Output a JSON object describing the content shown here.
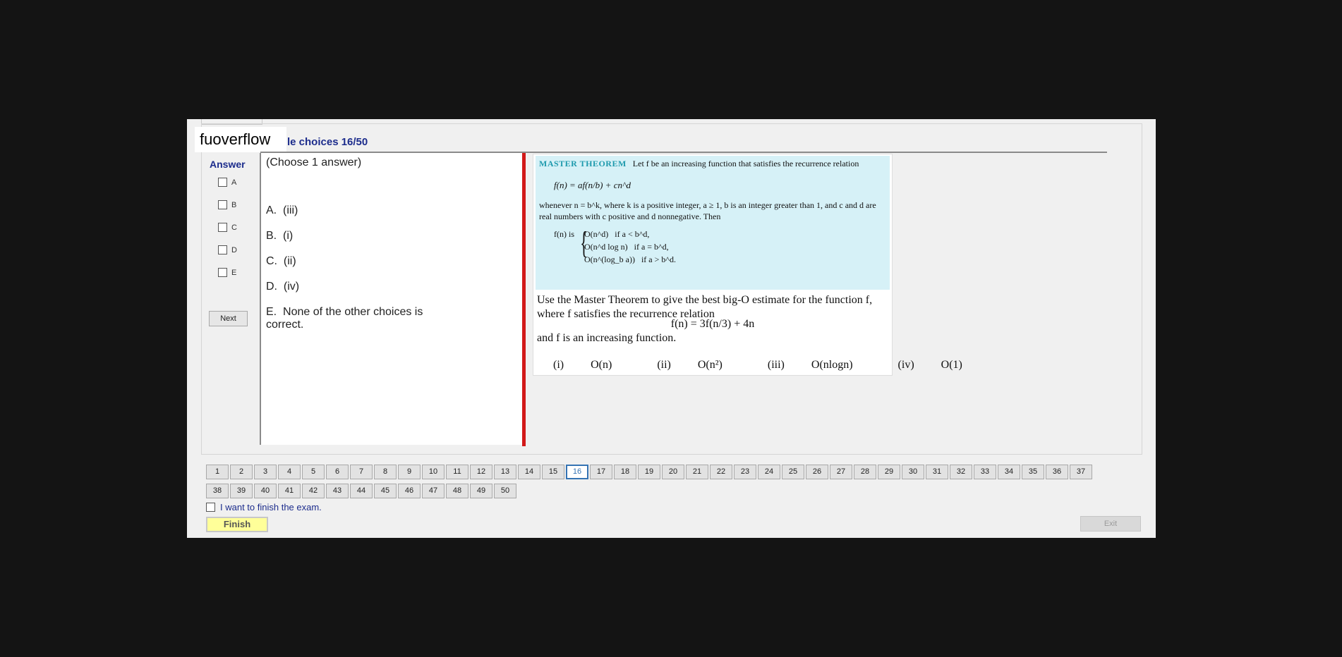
{
  "brand": "fuoverflow",
  "question_title": "le choices 16/50",
  "answer_panel": {
    "title": "Answer",
    "options": [
      "A",
      "B",
      "C",
      "D",
      "E"
    ],
    "next_label": "Next"
  },
  "choices": {
    "hint": "(Choose 1 answer)",
    "items": [
      {
        "letter": "A.",
        "text": "(iii)"
      },
      {
        "letter": "B.",
        "text": "(i)"
      },
      {
        "letter": "C.",
        "text": "(ii)"
      },
      {
        "letter": "D.",
        "text": "(iv)"
      },
      {
        "letter": "E.",
        "text": "None of the other choices is correct."
      }
    ]
  },
  "question": {
    "theorem_head": "MASTER THEOREM",
    "theorem_intro": "Let f be an increasing function that satisfies the recurrence relation",
    "theorem_eq": "f(n) = af(n/b) + cn^d",
    "theorem_para": "whenever n = b^k, where k is a positive integer, a ≥ 1, b is an integer greater than 1, and c and d are real numbers with c positive and d nonnegative. Then",
    "piece_label": "f(n) is",
    "cases": [
      {
        "expr": "O(n^d)",
        "cond": "if a < b^d,"
      },
      {
        "expr": "O(n^d log n)",
        "cond": "if a = b^d,"
      },
      {
        "expr": "O(n^(log_b a))",
        "cond": "if a > b^d."
      }
    ],
    "text1": "Use the Master Theorem to give the best big-O estimate for the function f, where f satisfies the recurrence relation",
    "formula": "f(n) = 3f(n/3) + 4n",
    "text2": "and f is an increasing function.",
    "options": [
      {
        "label": "(i)",
        "value": "O(n)"
      },
      {
        "label": "(ii)",
        "value": "O(n²)"
      },
      {
        "label": "(iii)",
        "value": "O(nlogn)"
      },
      {
        "label": "(iv)",
        "value": "O(1)"
      }
    ]
  },
  "nav": {
    "current": 16,
    "numbers": [
      1,
      2,
      3,
      4,
      5,
      6,
      7,
      8,
      9,
      10,
      11,
      12,
      13,
      14,
      15,
      16,
      17,
      18,
      19,
      20,
      21,
      22,
      23,
      24,
      25,
      26,
      27,
      28,
      29,
      30,
      31,
      32,
      33,
      34,
      35,
      36,
      37,
      38,
      39,
      40,
      41,
      42,
      43,
      44,
      45,
      46,
      47,
      48,
      49,
      50
    ]
  },
  "footer": {
    "finish_check_label": "I want to finish the exam.",
    "finish_label": "Finish",
    "exit_label": "Exit"
  }
}
